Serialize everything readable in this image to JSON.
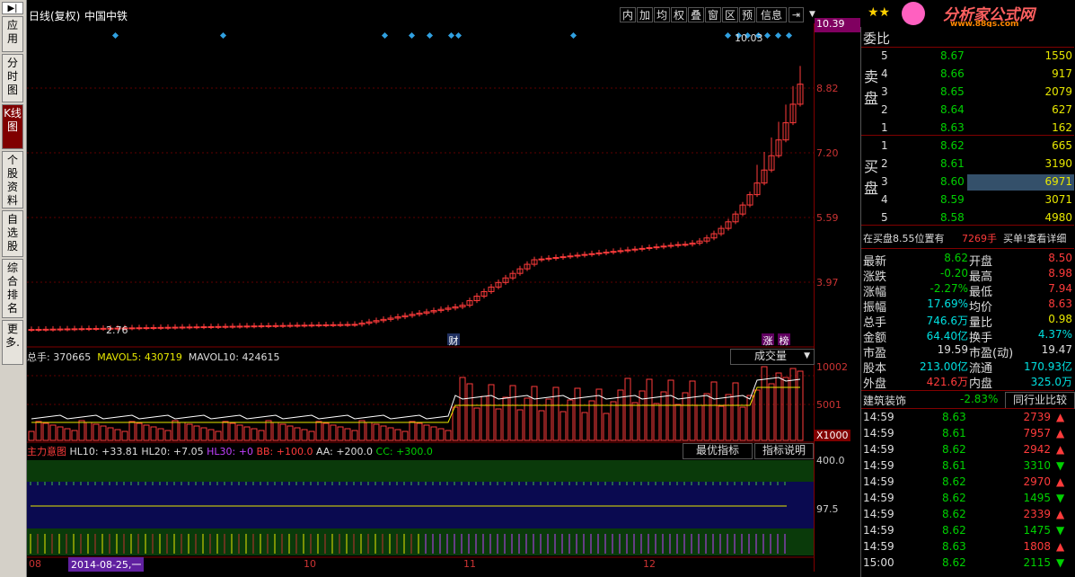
{
  "left_tabs": [
    {
      "label": "▶|"
    },
    {
      "label": "应用"
    },
    {
      "label": "分时图"
    },
    {
      "label": "K线图"
    },
    {
      "label": "个股资料"
    },
    {
      "label": "自选股"
    },
    {
      "label": "综合排名"
    },
    {
      "label": "更多."
    }
  ],
  "header": {
    "period": "日线(复权)",
    "stock_name": "中国中铁",
    "tools": [
      "内",
      "加",
      "均",
      "权",
      "叠",
      "窗",
      "区",
      "预",
      "信息"
    ],
    "lock_icon": "pin-icon",
    "dropdown_icon": "chevron-down-icon"
  },
  "price_axis": {
    "labels": [
      "10.39",
      "8.82",
      "7.20",
      "5.59",
      "3.97"
    ],
    "high_marker": "10.03",
    "low_marker": "2.76"
  },
  "annotations": {
    "cai": "财",
    "zhang": "涨",
    "bang": "榜"
  },
  "volume_panel": {
    "title": "总手: 370665",
    "mavol5": "MAVOL5: 430719",
    "mavol10": "MAVOL10: 424615",
    "selector": "成交量",
    "axis": [
      "10002",
      "5001",
      "X1000"
    ]
  },
  "indicator_panel": {
    "name": "主力意图",
    "hl10": "HL10: +33.81",
    "hl20": "HL20: +7.05",
    "hl30": "HL30: +0",
    "bb": "BB: +100.0",
    "aa": "AA: +200.0",
    "cc": "CC: +300.0",
    "btn_best": "最优指标",
    "btn_help": "指标说明",
    "axis": [
      "400.0",
      "97.5"
    ]
  },
  "time_axis": {
    "labels": [
      "08",
      "10",
      "11",
      "12"
    ],
    "cursor_date": "2014-08-25,一"
  },
  "logo": {
    "text": "分析家公式网",
    "url": "www.88gs.com"
  },
  "weibi": {
    "label": "委比"
  },
  "sell_label": "卖盘",
  "buy_label": "买盘",
  "sell": [
    {
      "n": "5",
      "price": "8.67",
      "vol": "1550"
    },
    {
      "n": "4",
      "price": "8.66",
      "vol": "917"
    },
    {
      "n": "3",
      "price": "8.65",
      "vol": "2079"
    },
    {
      "n": "2",
      "price": "8.64",
      "vol": "627"
    },
    {
      "n": "1",
      "price": "8.63",
      "vol": "162"
    }
  ],
  "buy": [
    {
      "n": "1",
      "price": "8.62",
      "vol": "665"
    },
    {
      "n": "2",
      "price": "8.61",
      "vol": "3190"
    },
    {
      "n": "3",
      "price": "8.60",
      "vol": "6971"
    },
    {
      "n": "4",
      "price": "8.59",
      "vol": "3071"
    },
    {
      "n": "5",
      "price": "8.58",
      "vol": "4980"
    }
  ],
  "notice": {
    "text": "在买盘8.55位置有",
    "vol": "7269手",
    "action": "买单!查看详细"
  },
  "quote": [
    {
      "l1": "最新",
      "v1": "8.62",
      "c1": "green",
      "l2": "开盘",
      "v2": "8.50",
      "c2": "red"
    },
    {
      "l1": "涨跌",
      "v1": "-0.20",
      "c1": "green",
      "l2": "最高",
      "v2": "8.98",
      "c2": "red"
    },
    {
      "l1": "涨幅",
      "v1": "-2.27%",
      "c1": "green",
      "l2": "最低",
      "v2": "7.94",
      "c2": "red"
    },
    {
      "l1": "振幅",
      "v1": "17.69%",
      "c1": "cyan",
      "l2": "均价",
      "v2": "8.63",
      "c2": "red"
    },
    {
      "l1": "总手",
      "v1": "746.6万",
      "c1": "cyan",
      "l2": "量比",
      "v2": "0.98",
      "c2": "yellow"
    },
    {
      "l1": "金额",
      "v1": "64.40亿",
      "c1": "cyan",
      "l2": "换手",
      "v2": "4.37%",
      "c2": "cyan"
    },
    {
      "l1": "市盈",
      "v1": "19.59",
      "c1": "white",
      "l2": "市盈(动)",
      "v2": "19.47",
      "c2": "white"
    },
    {
      "l1": "股本",
      "v1": "213.00亿",
      "c1": "cyan",
      "l2": "流通",
      "v2": "170.93亿",
      "c2": "cyan"
    },
    {
      "l1": "外盘",
      "v1": "421.6万",
      "c1": "red",
      "l2": "内盘",
      "v2": "325.0万",
      "c2": "cyan"
    }
  ],
  "industry": {
    "name": "建筑装饰",
    "change": "-2.83%",
    "btn": "同行业比较"
  },
  "ticks": [
    {
      "t": "14:59",
      "p": "8.63",
      "v": "2739",
      "dir": "up"
    },
    {
      "t": "14:59",
      "p": "8.61",
      "v": "7957",
      "dir": "up"
    },
    {
      "t": "14:59",
      "p": "8.62",
      "v": "2942",
      "dir": "up"
    },
    {
      "t": "14:59",
      "p": "8.61",
      "v": "3310",
      "dir": "down"
    },
    {
      "t": "14:59",
      "p": "8.62",
      "v": "2970",
      "dir": "up"
    },
    {
      "t": "14:59",
      "p": "8.62",
      "v": "1495",
      "dir": "down"
    },
    {
      "t": "14:59",
      "p": "8.62",
      "v": "2339",
      "dir": "up"
    },
    {
      "t": "14:59",
      "p": "8.62",
      "v": "1475",
      "dir": "down"
    },
    {
      "t": "14:59",
      "p": "8.63",
      "v": "1808",
      "dir": "up"
    },
    {
      "t": "15:00",
      "p": "8.62",
      "v": "2115",
      "dir": "down"
    }
  ],
  "colors": {
    "up": "#ff3b3b",
    "down": "#00d000",
    "cyan": "#00e0e0",
    "grid": "#800000"
  }
}
